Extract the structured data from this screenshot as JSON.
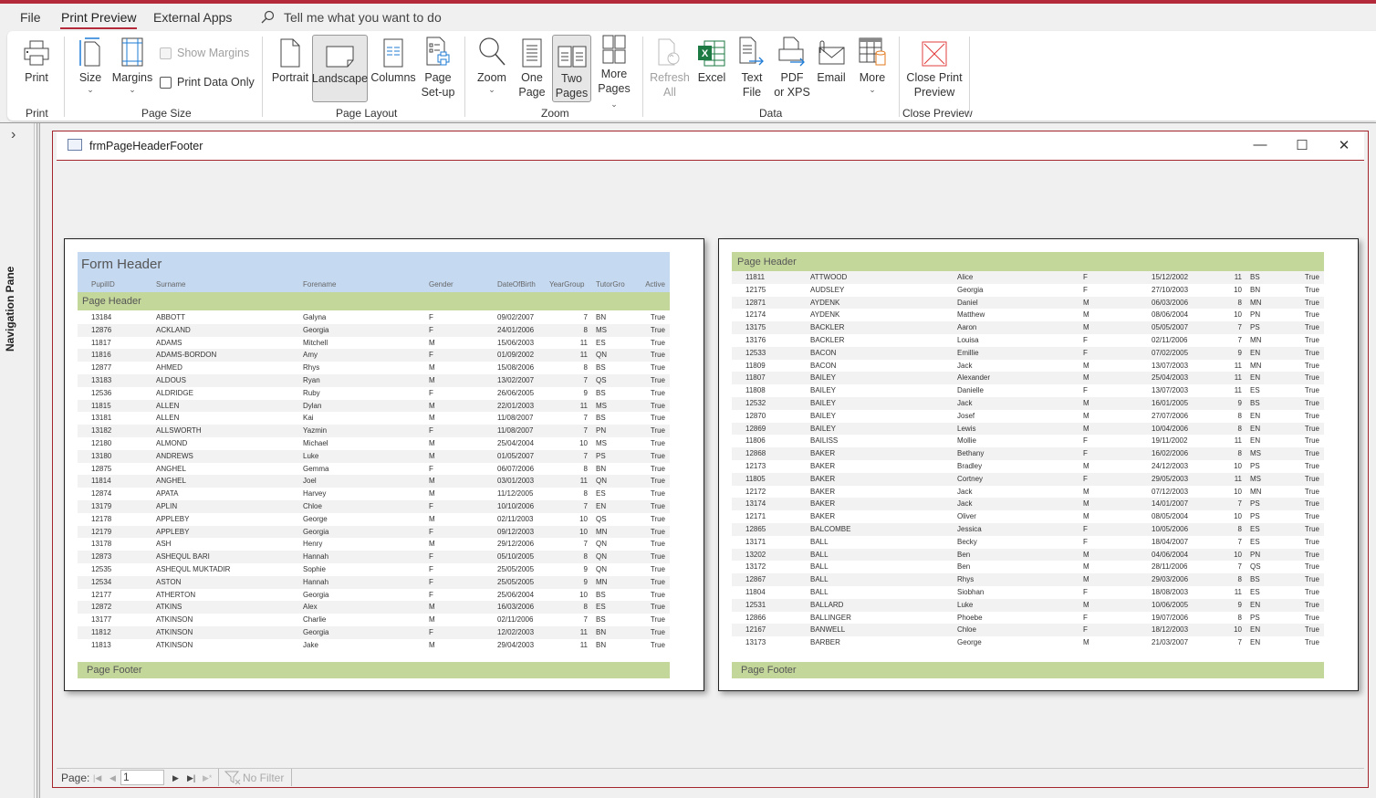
{
  "tabs": {
    "file": "File",
    "print_preview": "Print Preview",
    "external_apps": "External Apps",
    "tell_me": "Tell me what you want to do"
  },
  "ribbon": {
    "print": {
      "label": "Print",
      "group": "Print"
    },
    "page_size": {
      "size": "Size",
      "margins": "Margins",
      "show_margins": "Show Margins",
      "print_data_only": "Print Data Only",
      "group": "Page Size"
    },
    "page_layout": {
      "portrait": "Portrait",
      "landscape": "Landscape",
      "columns": "Columns",
      "page_setup_1": "Page",
      "page_setup_2": "Set-up",
      "group": "Page Layout"
    },
    "zoom": {
      "zoom": "Zoom",
      "one_page_1": "One",
      "one_page_2": "Page",
      "two_pages_1": "Two",
      "two_pages_2": "Pages",
      "more_pages_1": "More",
      "more_pages_2": "Pages",
      "group": "Zoom"
    },
    "data": {
      "refresh_1": "Refresh",
      "refresh_2": "All",
      "excel": "Excel",
      "text_file_1": "Text",
      "text_file_2": "File",
      "pdf_1": "PDF",
      "pdf_2": "or XPS",
      "email": "Email",
      "more": "More",
      "group": "Data"
    },
    "close": {
      "label_1": "Close Print",
      "label_2": "Preview",
      "group": "Close Preview"
    }
  },
  "nav_pane": {
    "label": "Navigation Pane"
  },
  "document": {
    "title": "frmPageHeaderFooter"
  },
  "report": {
    "form_header": "Form Header",
    "page_header": "Page Header",
    "page_footer": "Page Footer",
    "columns": [
      "PupilID",
      "Surname",
      "Forename",
      "Gender",
      "DateOfBirth",
      "YearGroup",
      "TutorGro",
      "Active"
    ],
    "page1_rows": [
      [
        "13184",
        "ABBOTT",
        "Galyna",
        "F",
        "09/02/2007",
        "7",
        "BN",
        "True"
      ],
      [
        "12876",
        "ACKLAND",
        "Georgia",
        "F",
        "24/01/2006",
        "8",
        "MS",
        "True"
      ],
      [
        "11817",
        "ADAMS",
        "Mitchell",
        "M",
        "15/06/2003",
        "11",
        "ES",
        "True"
      ],
      [
        "11816",
        "ADAMS-BORDON",
        "Amy",
        "F",
        "01/09/2002",
        "11",
        "QN",
        "True"
      ],
      [
        "12877",
        "AHMED",
        "Rhys",
        "M",
        "15/08/2006",
        "8",
        "BS",
        "True"
      ],
      [
        "13183",
        "ALDOUS",
        "Ryan",
        "M",
        "13/02/2007",
        "7",
        "QS",
        "True"
      ],
      [
        "12536",
        "ALDRIDGE",
        "Ruby",
        "F",
        "26/06/2005",
        "9",
        "BS",
        "True"
      ],
      [
        "11815",
        "ALLEN",
        "Dylan",
        "M",
        "22/01/2003",
        "11",
        "MS",
        "True"
      ],
      [
        "13181",
        "ALLEN",
        "Kai",
        "M",
        "11/08/2007",
        "7",
        "BS",
        "True"
      ],
      [
        "13182",
        "ALLSWORTH",
        "Yazmin",
        "F",
        "11/08/2007",
        "7",
        "PN",
        "True"
      ],
      [
        "12180",
        "ALMOND",
        "Michael",
        "M",
        "25/04/2004",
        "10",
        "MS",
        "True"
      ],
      [
        "13180",
        "ANDREWS",
        "Luke",
        "M",
        "01/05/2007",
        "7",
        "PS",
        "True"
      ],
      [
        "12875",
        "ANGHEL",
        "Gemma",
        "F",
        "06/07/2006",
        "8",
        "BN",
        "True"
      ],
      [
        "11814",
        "ANGHEL",
        "Joel",
        "M",
        "03/01/2003",
        "11",
        "QN",
        "True"
      ],
      [
        "12874",
        "APATA",
        "Harvey",
        "M",
        "11/12/2005",
        "8",
        "ES",
        "True"
      ],
      [
        "13179",
        "APLIN",
        "Chloe",
        "F",
        "10/10/2006",
        "7",
        "EN",
        "True"
      ],
      [
        "12178",
        "APPLEBY",
        "George",
        "M",
        "02/11/2003",
        "10",
        "QS",
        "True"
      ],
      [
        "12179",
        "APPLEBY",
        "Georgia",
        "F",
        "09/12/2003",
        "10",
        "MN",
        "True"
      ],
      [
        "13178",
        "ASH",
        "Henry",
        "M",
        "29/12/2006",
        "7",
        "QN",
        "True"
      ],
      [
        "12873",
        "ASHEQUL BARI",
        "Hannah",
        "F",
        "05/10/2005",
        "8",
        "QN",
        "True"
      ],
      [
        "12535",
        "ASHEQUL MUKTADIR",
        "Sophie",
        "F",
        "25/05/2005",
        "9",
        "QN",
        "True"
      ],
      [
        "12534",
        "ASTON",
        "Hannah",
        "F",
        "25/05/2005",
        "9",
        "MN",
        "True"
      ],
      [
        "12177",
        "ATHERTON",
        "Georgia",
        "F",
        "25/06/2004",
        "10",
        "BS",
        "True"
      ],
      [
        "12872",
        "ATKINS",
        "Alex",
        "M",
        "16/03/2006",
        "8",
        "ES",
        "True"
      ],
      [
        "13177",
        "ATKINSON",
        "Charlie",
        "M",
        "02/11/2006",
        "7",
        "BS",
        "True"
      ],
      [
        "11812",
        "ATKINSON",
        "Georgia",
        "F",
        "12/02/2003",
        "11",
        "BN",
        "True"
      ],
      [
        "11813",
        "ATKINSON",
        "Jake",
        "M",
        "29/04/2003",
        "11",
        "BN",
        "True"
      ]
    ],
    "page2_rows": [
      [
        "11811",
        "ATTWOOD",
        "Alice",
        "F",
        "15/12/2002",
        "11",
        "BS",
        "True"
      ],
      [
        "12175",
        "AUDSLEY",
        "Georgia",
        "F",
        "27/10/2003",
        "10",
        "BN",
        "True"
      ],
      [
        "12871",
        "AYDENK",
        "Daniel",
        "M",
        "06/03/2006",
        "8",
        "MN",
        "True"
      ],
      [
        "12174",
        "AYDENK",
        "Matthew",
        "M",
        "08/06/2004",
        "10",
        "PN",
        "True"
      ],
      [
        "13175",
        "BACKLER",
        "Aaron",
        "M",
        "05/05/2007",
        "7",
        "PS",
        "True"
      ],
      [
        "13176",
        "BACKLER",
        "Louisa",
        "F",
        "02/11/2006",
        "7",
        "MN",
        "True"
      ],
      [
        "12533",
        "BACON",
        "Emillie",
        "F",
        "07/02/2005",
        "9",
        "EN",
        "True"
      ],
      [
        "11809",
        "BACON",
        "Jack",
        "M",
        "13/07/2003",
        "11",
        "MN",
        "True"
      ],
      [
        "11807",
        "BAILEY",
        "Alexander",
        "M",
        "25/04/2003",
        "11",
        "EN",
        "True"
      ],
      [
        "11808",
        "BAILEY",
        "Danielle",
        "F",
        "13/07/2003",
        "11",
        "ES",
        "True"
      ],
      [
        "12532",
        "BAILEY",
        "Jack",
        "M",
        "16/01/2005",
        "9",
        "BS",
        "True"
      ],
      [
        "12870",
        "BAILEY",
        "Josef",
        "M",
        "27/07/2006",
        "8",
        "EN",
        "True"
      ],
      [
        "12869",
        "BAILEY",
        "Lewis",
        "M",
        "10/04/2006",
        "8",
        "EN",
        "True"
      ],
      [
        "11806",
        "BAILISS",
        "Mollie",
        "F",
        "19/11/2002",
        "11",
        "EN",
        "True"
      ],
      [
        "12868",
        "BAKER",
        "Bethany",
        "F",
        "16/02/2006",
        "8",
        "MS",
        "True"
      ],
      [
        "12173",
        "BAKER",
        "Bradley",
        "M",
        "24/12/2003",
        "10",
        "PS",
        "True"
      ],
      [
        "11805",
        "BAKER",
        "Cortney",
        "F",
        "29/05/2003",
        "11",
        "MS",
        "True"
      ],
      [
        "12172",
        "BAKER",
        "Jack",
        "M",
        "07/12/2003",
        "10",
        "MN",
        "True"
      ],
      [
        "13174",
        "BAKER",
        "Jack",
        "M",
        "14/01/2007",
        "7",
        "PS",
        "True"
      ],
      [
        "12171",
        "BAKER",
        "Oliver",
        "M",
        "08/05/2004",
        "10",
        "PS",
        "True"
      ],
      [
        "12865",
        "BALCOMBE",
        "Jessica",
        "F",
        "10/05/2006",
        "8",
        "ES",
        "True"
      ],
      [
        "13171",
        "BALL",
        "Becky",
        "F",
        "18/04/2007",
        "7",
        "ES",
        "True"
      ],
      [
        "13202",
        "BALL",
        "Ben",
        "M",
        "04/06/2004",
        "10",
        "PN",
        "True"
      ],
      [
        "13172",
        "BALL",
        "Ben",
        "M",
        "28/11/2006",
        "7",
        "QS",
        "True"
      ],
      [
        "12867",
        "BALL",
        "Rhys",
        "M",
        "29/03/2006",
        "8",
        "BS",
        "True"
      ],
      [
        "11804",
        "BALL",
        "Siobhan",
        "F",
        "18/08/2003",
        "11",
        "ES",
        "True"
      ],
      [
        "12531",
        "BALLARD",
        "Luke",
        "M",
        "10/06/2005",
        "9",
        "EN",
        "True"
      ],
      [
        "12866",
        "BALLINGER",
        "Phoebe",
        "F",
        "19/07/2006",
        "8",
        "PS",
        "True"
      ],
      [
        "12167",
        "BANWELL",
        "Chloe",
        "F",
        "18/12/2003",
        "10",
        "EN",
        "True"
      ],
      [
        "13173",
        "BARBER",
        "George",
        "M",
        "21/03/2007",
        "7",
        "EN",
        "True"
      ]
    ]
  },
  "status": {
    "page_label": "Page:",
    "page_value": "1",
    "no_filter": "No Filter"
  }
}
